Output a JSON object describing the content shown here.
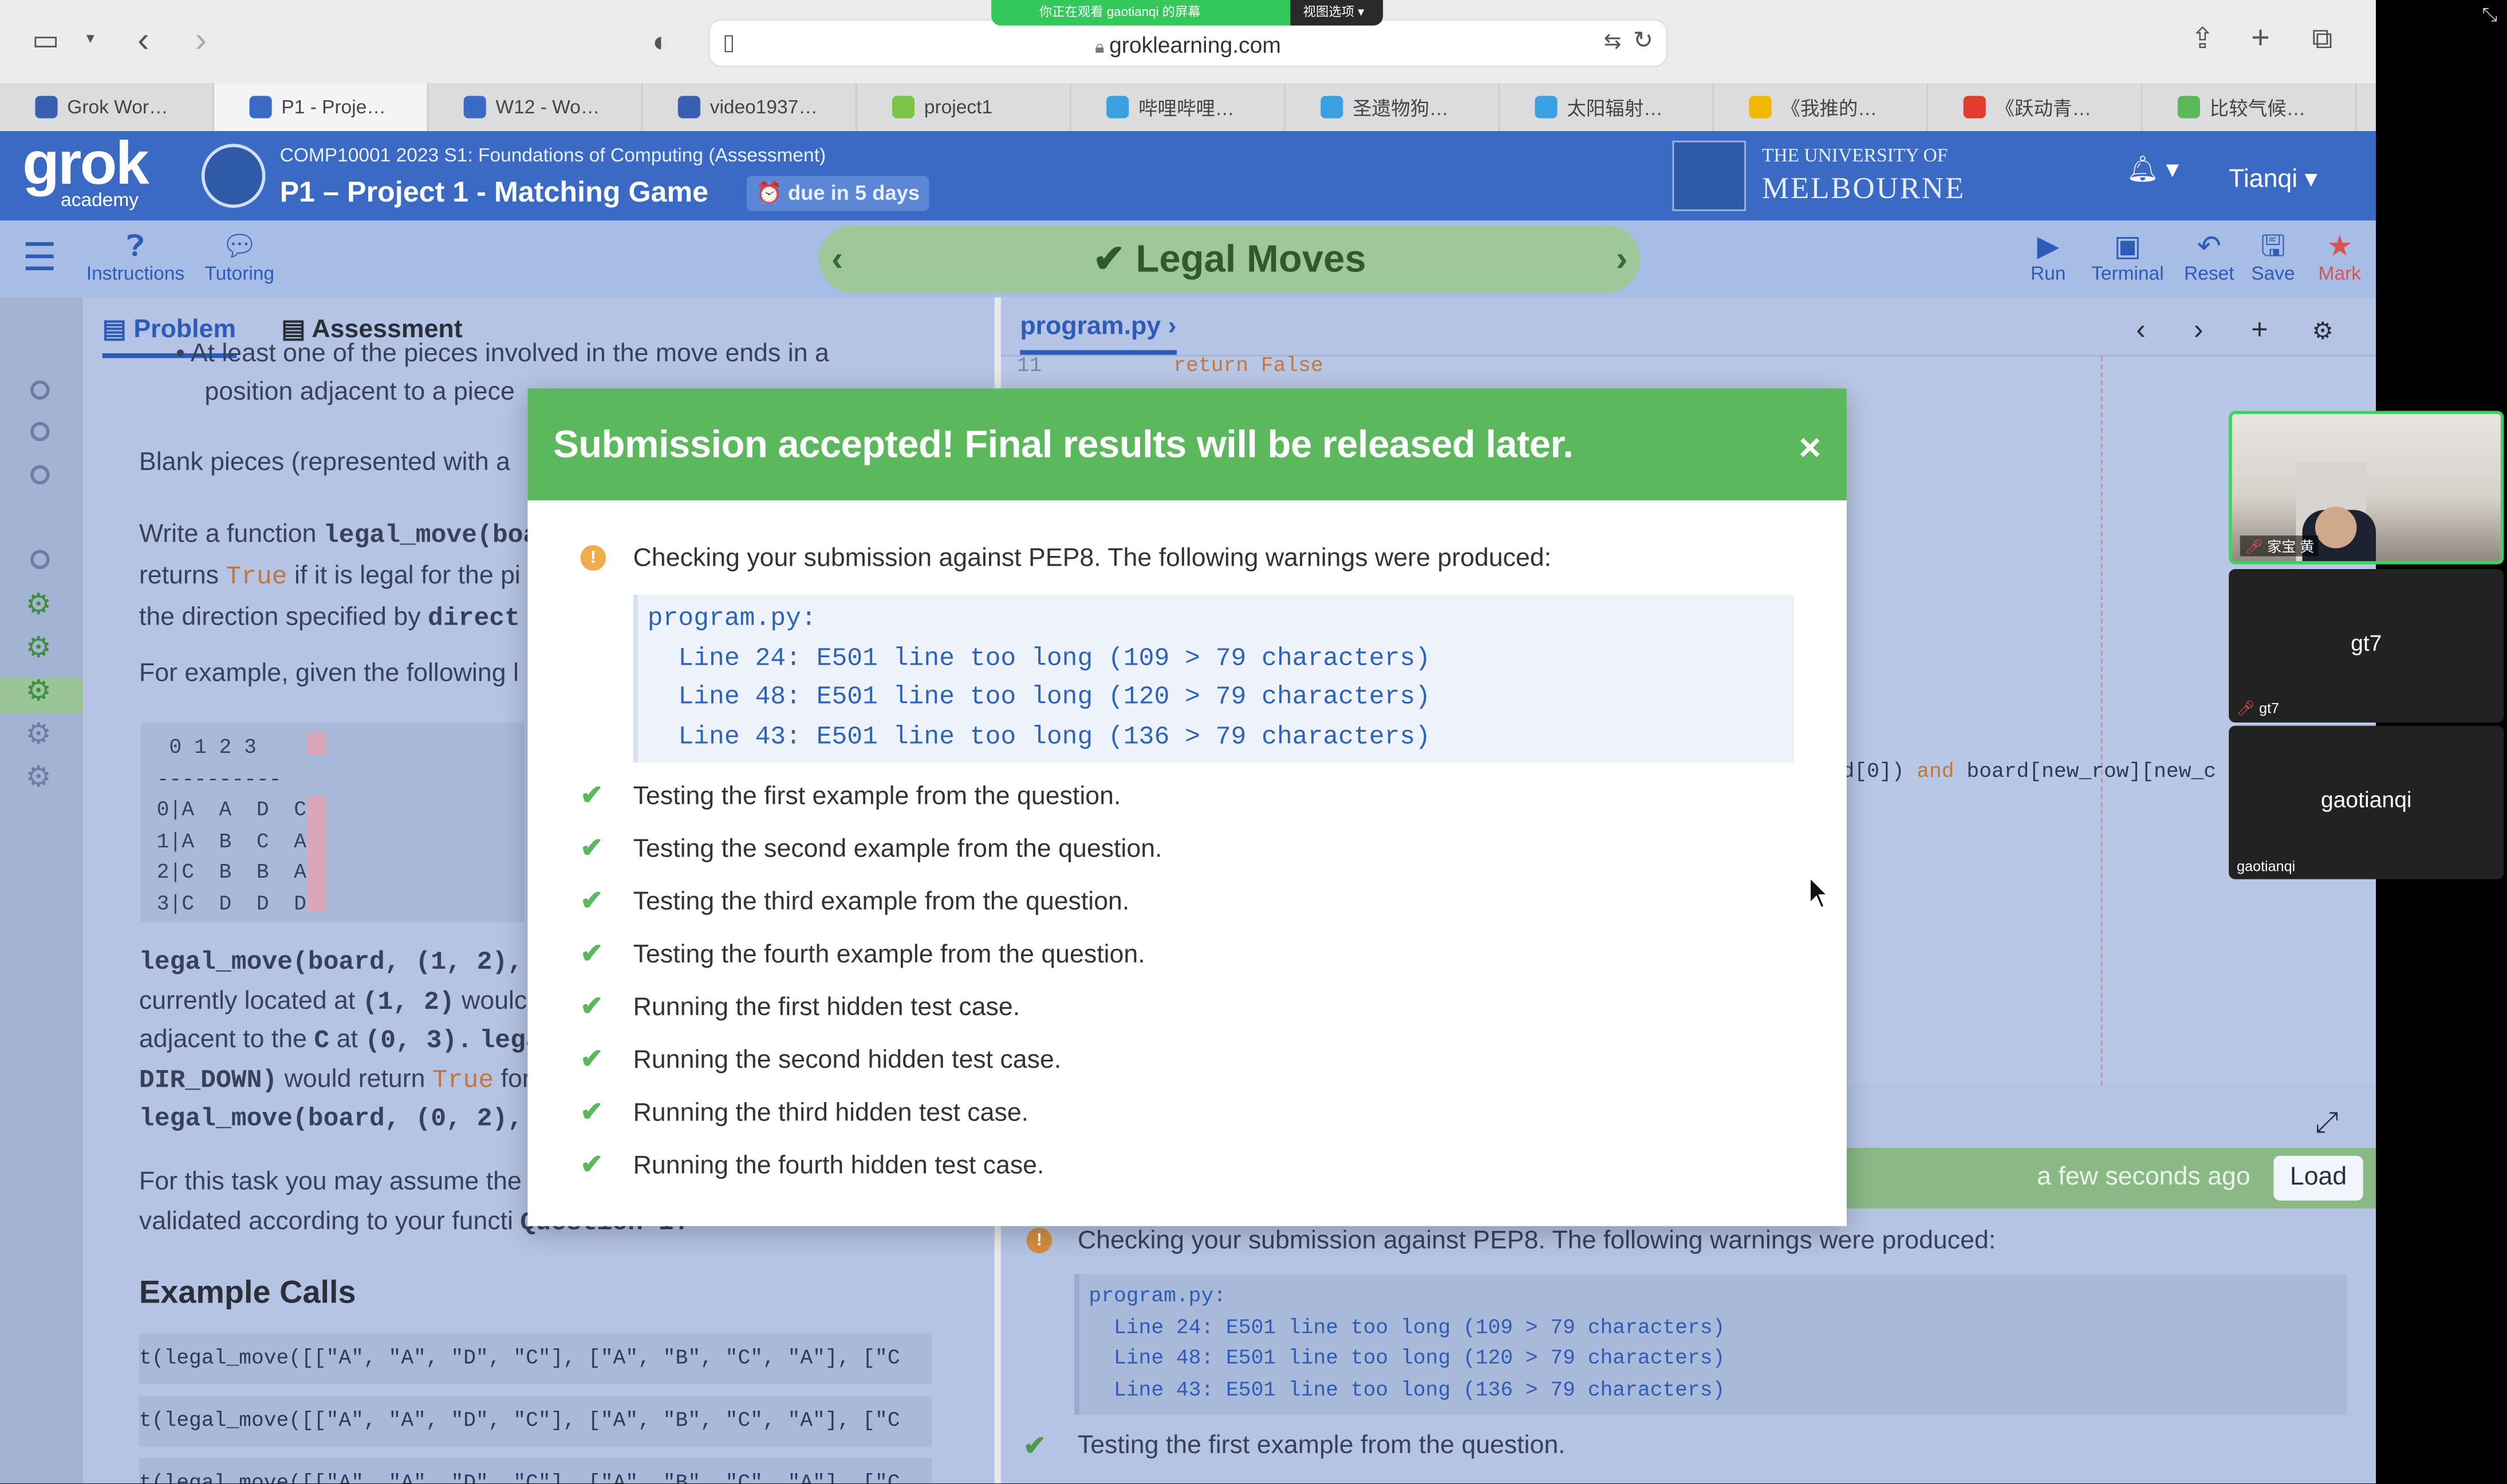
{
  "browser": {
    "url": "groklearning.com",
    "share_banner": "你正在观看 gaotianqi 的屏幕",
    "share_options": "视图选项",
    "tabs": [
      {
        "label": "Grok Wor…",
        "color": "#3a5fb0"
      },
      {
        "label": "P1 - Proje…",
        "color": "#3a6ac4"
      },
      {
        "label": "W12 - Wo…",
        "color": "#3a6ac4"
      },
      {
        "label": "video1937…",
        "color": "#3a5fb0"
      },
      {
        "label": "project1",
        "color": "#7cc34a"
      },
      {
        "label": "哔哩哔哩…",
        "color": "#3aa0e0"
      },
      {
        "label": "圣遗物狗…",
        "color": "#3aa0e0"
      },
      {
        "label": "太阳辐射…",
        "color": "#3aa0e0"
      },
      {
        "label": "《我推的…",
        "color": "#f2b800"
      },
      {
        "label": "《跃动青…",
        "color": "#e33b2e"
      },
      {
        "label": "比较气候…",
        "color": "#5bb85b"
      }
    ]
  },
  "header": {
    "logo": "grok",
    "logo_sub": "academy",
    "course": "COMP10001 2023 S1: Foundations of Computing (Assessment)",
    "project": "P1 – Project 1 - Matching Game",
    "due": "due in 5 days",
    "university_top": "THE UNIVERSITY OF",
    "university_bottom": "MELBOURNE",
    "user": "Tianqi"
  },
  "toolbar": {
    "instructions": "Instructions",
    "tutoring": "Tutoring",
    "slide_title": "Legal Moves",
    "run": "Run",
    "terminal": "Terminal",
    "reset": "Reset",
    "save": "Save",
    "mark": "Mark"
  },
  "left": {
    "tab_problem": "Problem",
    "tab_assessment": "Assessment",
    "bullet_1": "At least one of the pieces involved in the move ends in a",
    "bullet_2": "position adjacent to a piece",
    "blank_line": "Blank pieces (represented with a",
    "p2_l1_a": "Write a function",
    "p2_l1_code": "legal_move(boa",
    "p2_l2_a": "returns",
    "p2_l2_true": "True",
    "p2_l2_b": "if it is legal for the pi",
    "p2_l3_a": "the direction specified by",
    "p2_l3_code": "direct",
    "example_intro": "For example, given the following l",
    "grid_header": " 0 1 2 3",
    "grid_sep": "----------",
    "grid_rows": [
      "0|A  A  D  C",
      "1|A  B  C  A",
      "2|C  B  B  A",
      "3|C  D  D  D"
    ],
    "ex_l1_code": "legal_move(board, (1, 2), DI",
    "ex_l2_a": "currently located at",
    "ex_l2_code": "(1, 2)",
    "ex_l2_b": "woulc",
    "ex_l3_a": "adjacent to the",
    "ex_l3_c": "C",
    "ex_l3_b": "at",
    "ex_l3_code": "(0, 3).",
    "ex_l3_code2": "lega",
    "ex_l4_code": "DIR_DOWN)",
    "ex_l4_a": "would return",
    "ex_l4_true": "True",
    "ex_l4_b": "for",
    "ex_l5_code": "legal_move(board, (0, 2), DI",
    "task_l1": "For this task you may assume the",
    "task_l2": "validated according to your functi",
    "task_l2_code": "Question 1.",
    "example_calls": "Example Calls",
    "calls": [
      "t(legal_move([[\"A\", \"A\", \"D\", \"C\"], [\"A\", \"B\", \"C\", \"A\"], [\"C",
      "t(legal_move([[\"A\", \"A\", \"D\", \"C\"], [\"A\", \"B\", \"C\", \"A\"], [\"C",
      "t(legal_move([[\"A\", \"A\", \"D\", \"C\"], [\"A\", \"B\", \"C\", \"A\"], [\"C"
    ]
  },
  "editor": {
    "file_tab": "program.py",
    "line_no": "11",
    "line_code": "return False",
    "partial_line_a": "d[0])",
    "partial_line_kw": "and",
    "partial_line_b": "board[new_row][new_c",
    "status_time": "a few seconds ago",
    "load_button": "Load"
  },
  "modal": {
    "title": "Submission accepted! Final results will be released later.",
    "close": "×",
    "pep8_intro": "Checking your submission against PEP8. The following warnings were produced:",
    "code_file": "program.py:",
    "code_lines": [
      "  Line 24: E501 line too long (109 > 79 characters)",
      "  Line 48: E501 line too long (120 > 79 characters)",
      "  Line 43: E501 line too long (136 > 79 characters)"
    ],
    "tests": [
      "Testing the first example from the question.",
      "Testing the second example from the question.",
      "Testing the third example from the question.",
      "Testing the fourth example from the question.",
      "Running the first hidden test case.",
      "Running the second hidden test case.",
      "Running the third hidden test case.",
      "Running the fourth hidden test case."
    ]
  },
  "background_results": {
    "pep8_intro": "Checking your submission against PEP8. The following warnings were produced:",
    "code_file": "program.py:",
    "code_lines": [
      "  Line 24: E501 line too long (109 > 79 characters)",
      "  Line 48: E501 line too long (120 > 79 characters)",
      "  Line 43: E501 line too long (136 > 79 characters)"
    ],
    "first_test": "Testing the first example from the question."
  },
  "participants": [
    {
      "tag": "家宝 黄",
      "has_video": true
    },
    {
      "name": "gt7",
      "tag": "gt7"
    },
    {
      "name": "gaotianqi",
      "tag": "gaotianqi"
    }
  ],
  "colors": {
    "accept_green": "#5cb85c",
    "grok_blue": "#3a6ac4",
    "warning_orange": "#f0ad4e"
  }
}
